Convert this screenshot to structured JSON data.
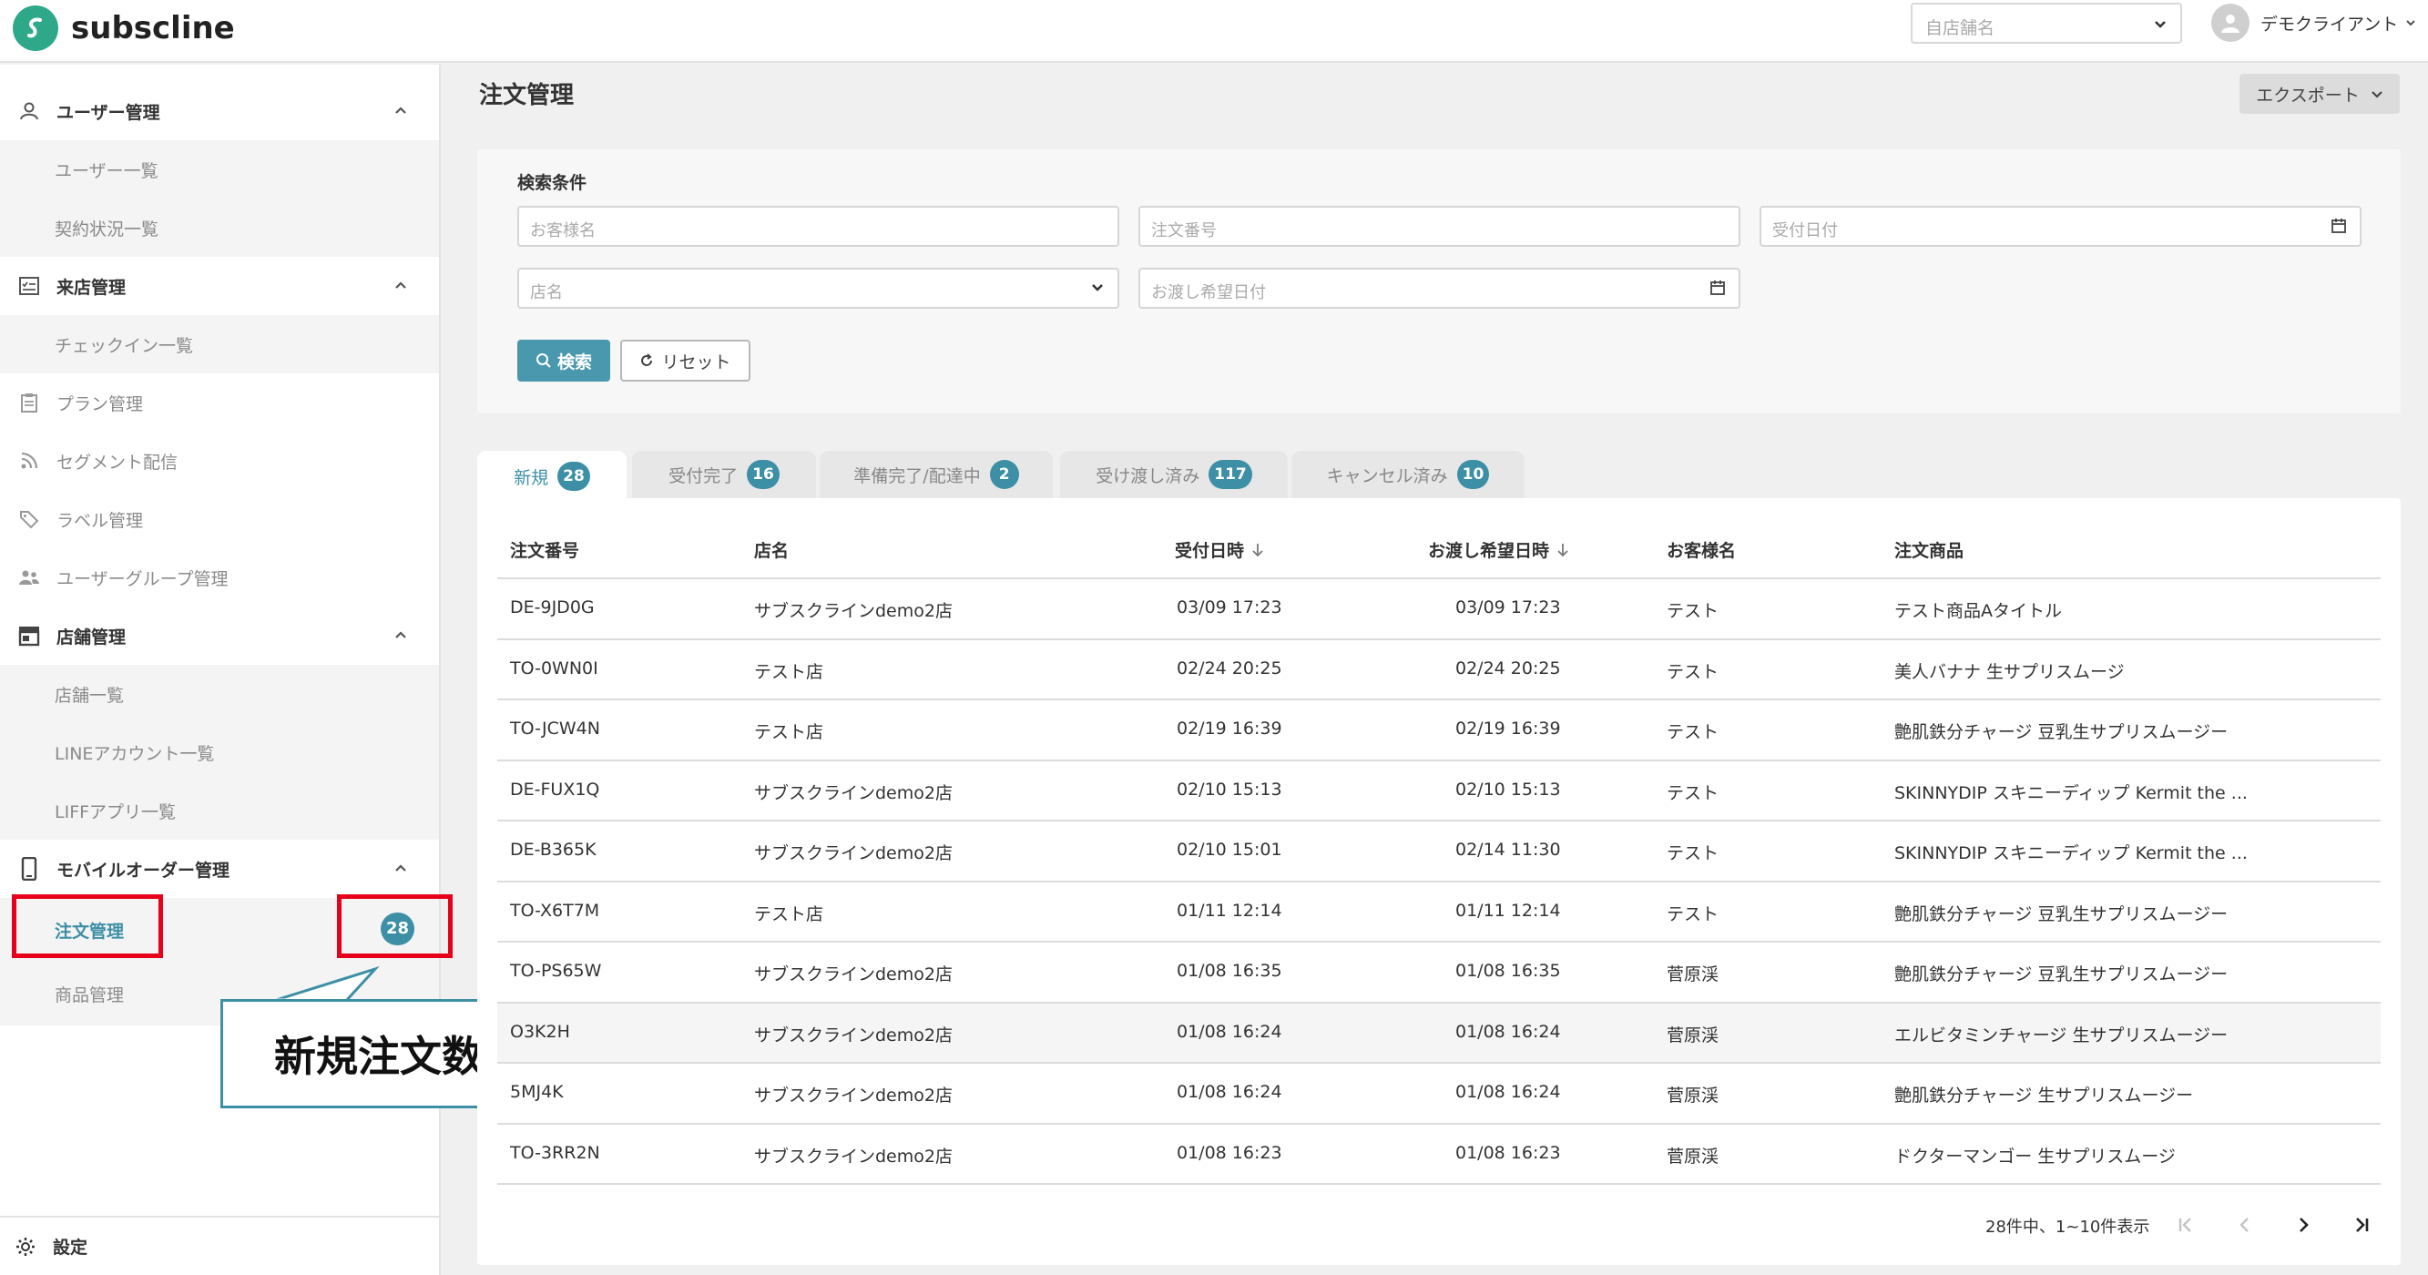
{
  "header": {
    "brand": "subscline",
    "store_placeholder": "自店舗名",
    "user_name": "デモクライアント"
  },
  "sidebar": {
    "sections": [
      {
        "label": "ユーザー管理",
        "children": [
          "ユーザー一覧",
          "契約状況一覧"
        ]
      },
      {
        "label": "来店管理",
        "children": [
          "チェックイン一覧"
        ]
      },
      {
        "label": "プラン管理"
      },
      {
        "label": "セグメント配信"
      },
      {
        "label": "ラベル管理"
      },
      {
        "label": "ユーザーグループ管理"
      },
      {
        "label": "店舗管理",
        "children": [
          "店舗一覧",
          "LINEアカウント一覧",
          "LIFFアプリ一覧"
        ]
      },
      {
        "label": "モバイルオーダー管理",
        "children": [
          "注文管理",
          "商品管理"
        ]
      }
    ],
    "order_badge": "28",
    "settings_label": "設定"
  },
  "annotation": {
    "callout_text": "新規注文数"
  },
  "main": {
    "title": "注文管理",
    "export_label": "エクスポート",
    "search": {
      "title": "検索条件",
      "customer_placeholder": "お客様名",
      "order_no_placeholder": "注文番号",
      "received_date_placeholder": "受付日付",
      "store_placeholder": "店名",
      "handover_date_placeholder": "お渡し希望日付",
      "search_button": "検索",
      "reset_button": "リセット"
    },
    "tabs": [
      {
        "label": "新規",
        "count": "28"
      },
      {
        "label": "受付完了",
        "count": "16"
      },
      {
        "label": "準備完了/配達中",
        "count": "2"
      },
      {
        "label": "受け渡し済み",
        "count": "117"
      },
      {
        "label": "キャンセル済み",
        "count": "10"
      }
    ],
    "table": {
      "headers": [
        "注文番号",
        "店名",
        "受付日時",
        "お渡し希望日時",
        "お客様名",
        "注文商品"
      ],
      "rows": [
        [
          "DE-9JD0G",
          "サブスクラインdemo2店",
          "03/09 17:23",
          "03/09 17:23",
          "テスト",
          "テスト商品Aタイトル"
        ],
        [
          "TO-0WN0I",
          "テスト店",
          "02/24 20:25",
          "02/24 20:25",
          "テスト",
          "美人バナナ 生サプリスムージ"
        ],
        [
          "TO-JCW4N",
          "テスト店",
          "02/19 16:39",
          "02/19 16:39",
          "テスト",
          "艶肌鉄分チャージ 豆乳生サプリスムージー"
        ],
        [
          "DE-FUX1Q",
          "サブスクラインdemo2店",
          "02/10 15:13",
          "02/10 15:13",
          "テスト",
          "SKINNYDIP スキニーディップ Kermit the ..."
        ],
        [
          "DE-B365K",
          "サブスクラインdemo2店",
          "02/10 15:01",
          "02/14 11:30",
          "テスト",
          "SKINNYDIP スキニーディップ Kermit the ..."
        ],
        [
          "TO-X6T7M",
          "テスト店",
          "01/11 12:14",
          "01/11 12:14",
          "テスト",
          "艶肌鉄分チャージ 豆乳生サプリスムージー"
        ],
        [
          "TO-PS65W",
          "サブスクラインdemo2店",
          "01/08 16:35",
          "01/08 16:35",
          "菅原渓",
          "艶肌鉄分チャージ 豆乳生サプリスムージー"
        ],
        [
          "O3K2H",
          "サブスクラインdemo2店",
          "01/08 16:24",
          "01/08 16:24",
          "菅原渓",
          "エルビタミンチャージ 生サプリスムージー"
        ],
        [
          "5MJ4K",
          "サブスクラインdemo2店",
          "01/08 16:24",
          "01/08 16:24",
          "菅原渓",
          "艶肌鉄分チャージ 生サプリスムージー"
        ],
        [
          "TO-3RR2N",
          "サブスクラインdemo2店",
          "01/08 16:23",
          "01/08 16:23",
          "菅原渓",
          "ドクターマンゴー 生サプリスムージ"
        ]
      ]
    },
    "pagination_text": "28件中、1~10件表示"
  },
  "colors": {
    "accent": "#3d8fa6",
    "highlight": "#e6001a",
    "brand_green": "#2fa88a"
  }
}
